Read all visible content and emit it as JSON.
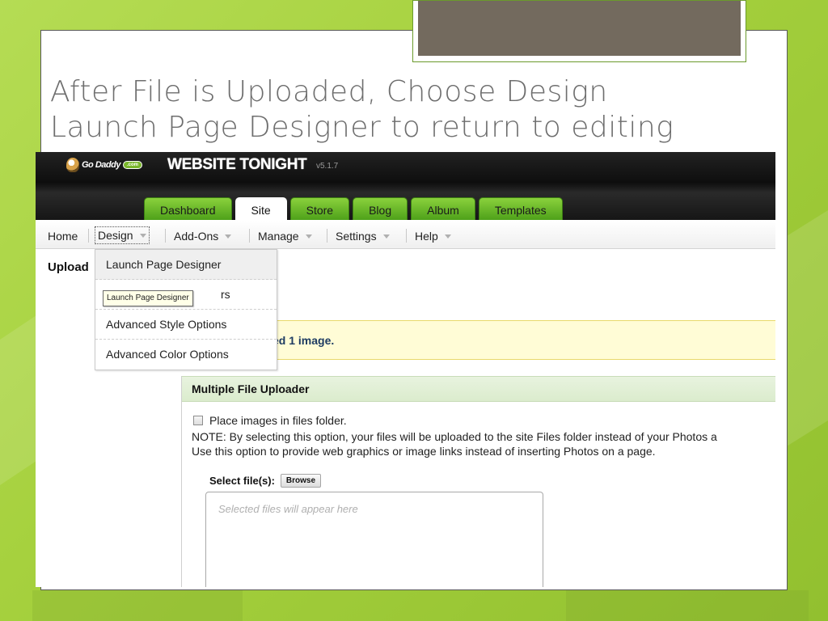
{
  "slide": {
    "title_line1": "After File is Uploaded, Choose Design",
    "title_line2": "Launch Page Designer to return to editing"
  },
  "app": {
    "logo_text": "Go Daddy",
    "logo_com": ".com",
    "product_name": "WEBSITE TONIGHT",
    "version": "v5.1.7"
  },
  "tabs": [
    {
      "label": "Dashboard",
      "active": false
    },
    {
      "label": "Site",
      "active": true
    },
    {
      "label": "Store",
      "active": false
    },
    {
      "label": "Blog",
      "active": false
    },
    {
      "label": "Album",
      "active": false
    },
    {
      "label": "Templates",
      "active": false
    }
  ],
  "menu": {
    "home": "Home",
    "design": "Design",
    "addons": "Add-Ons",
    "manage": "Manage",
    "settings": "Settings",
    "help": "Help"
  },
  "dropdown": {
    "items": [
      "Launch Page Designer",
      "rs",
      "Advanced Style Options",
      "Advanced Color Options"
    ]
  },
  "tooltip": "Launch Page Designer",
  "page": {
    "heading": "Upload",
    "alert_text": "ed 1 image."
  },
  "uploader": {
    "title": "Multiple File Uploader",
    "checkbox_label": "Place images in files folder.",
    "checkbox_checked": false,
    "note_line1": "NOTE:  By selecting this option, your files will be uploaded to the site Files folder instead of your Photos a",
    "note_line2": "Use this option to provide web graphics or image links instead of inserting Photos on a page.",
    "select_label": "Select file(s):",
    "browse_label": "Browse",
    "files_placeholder": "Selected files will appear here"
  },
  "colors": {
    "background_green": "#a6d13e",
    "tab_green": "#6bbd2a",
    "title_gray": "#6e6e6e",
    "header_black": "#111111",
    "top_box_fill": "#736a5e"
  }
}
